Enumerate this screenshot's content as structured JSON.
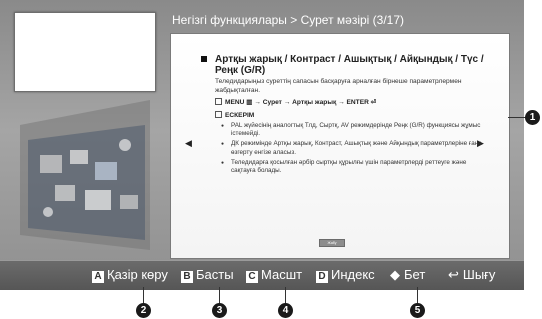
{
  "header": {
    "title": "Негізгі функциялары > Сурет мәзірі (3/17)"
  },
  "panel": {
    "heading": "Артқы жарық / Контраст / Ашықтық / Айқындық / Түс / Реңк (G/R)",
    "description": "Теледидарыңыз суреттің сапасын басқаруға арналған бірнеше параметрлермен жабдықталған.",
    "menu_path": "MENU ▥ → Сурет → Артқы жарық → ENTER ⏎",
    "note_label": "ЕСКЕРІМ",
    "notes": [
      "PAL жүйесінің аналогтық Тлд, Сыртқ, AV режимдерінде Реңк (G/R) функциясы жұмыс істемейді.",
      "ДК режимінде Артқы жарық, Контраст, Ашықтық және Айқындық параметрлеріне ғана өзгерту енгізе аласыз.",
      "Теледидарға қосылған әрбір сыртқы құрылғы үшін параметрлерді реттеуге және сақтауға болады."
    ],
    "close_label": "Жабу",
    "prev_arrow": "◀",
    "next_arrow": "▶"
  },
  "bottom_bar": {
    "buttons": [
      {
        "key": "A",
        "label": "Қазір көру"
      },
      {
        "key": "B",
        "label": "Басты"
      },
      {
        "key": "C",
        "label": "Масшт"
      },
      {
        "key": "D",
        "label": "Индекс"
      },
      {
        "key": "◆",
        "label": "Бет"
      },
      {
        "key": "↩",
        "label": "Шығу"
      }
    ]
  },
  "callouts": [
    "1",
    "2",
    "3",
    "4",
    "5"
  ],
  "colors": {
    "screen_bg": "#9a9a9a",
    "bar_bg": "#5e5e5e",
    "panel_bg": "#ffffff"
  }
}
